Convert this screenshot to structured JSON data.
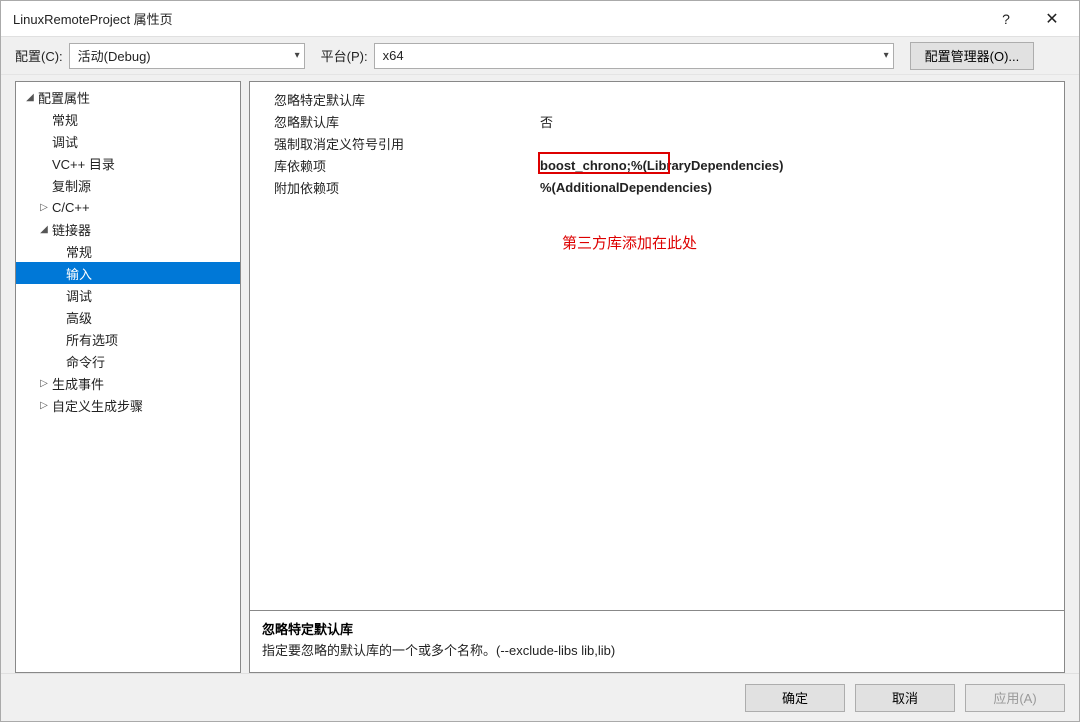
{
  "titlebar": {
    "title": "LinuxRemoteProject 属性页",
    "help": "?",
    "close": "✕"
  },
  "config_row": {
    "config_label": "配置(C):",
    "config_value": "活动(Debug)",
    "platform_label": "平台(P):",
    "platform_value": "x64",
    "manager_button": "配置管理器(O)..."
  },
  "tree": {
    "root": "配置属性",
    "general": "常规",
    "debug": "调试",
    "vcpp_dirs": "VC++ 目录",
    "copy_source": "复制源",
    "ccpp": "C/C++",
    "linker": "链接器",
    "linker_general": "常规",
    "linker_input": "输入",
    "linker_debug": "调试",
    "linker_advanced": "高级",
    "linker_all": "所有选项",
    "linker_cmdline": "命令行",
    "build_events": "生成事件",
    "custom_build": "自定义生成步骤"
  },
  "properties": {
    "rows": [
      {
        "label": "忽略特定默认库",
        "value": ""
      },
      {
        "label": "忽略默认库",
        "value": "否"
      },
      {
        "label": "强制取消定义符号引用",
        "value": ""
      },
      {
        "label": "库依赖项",
        "value_pre": "boost_chrono;%",
        "value_post": "(LibraryDependencies)"
      },
      {
        "label": "附加依赖项",
        "value": "%(AdditionalDependencies)"
      }
    ],
    "annotation": "第三方库添加在此处"
  },
  "description": {
    "title": "忽略特定默认库",
    "text": "指定要忽略的默认库的一个或多个名称。(--exclude-libs lib,lib)"
  },
  "footer": {
    "ok": "确定",
    "cancel": "取消",
    "apply": "应用(A)"
  }
}
